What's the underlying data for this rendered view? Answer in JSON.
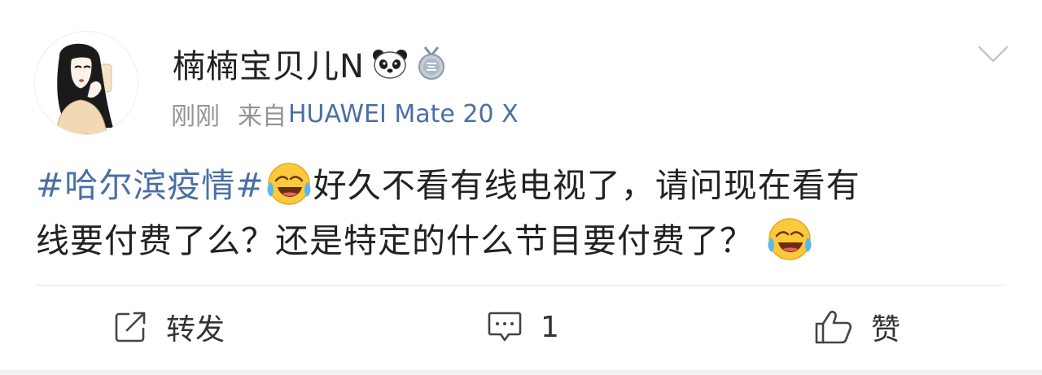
{
  "post": {
    "author": {
      "name": "楠楠宝贝儿N",
      "avatar_icon": "avatar-girl-illustration",
      "badges": [
        "panda-icon",
        "medal-badge-icon"
      ]
    },
    "time": "刚刚",
    "source_prefix": "来自",
    "source_device": "HUAWEI Mate 20 X",
    "menu_icon": "chevron-down-icon",
    "content": {
      "hashtag": "#哈尔滨疫情#",
      "line1_text": "好久不看有线电视了，请问现在看有",
      "line2_text": "线要付费了么？还是特定的什么节目要付费了？",
      "emoji": "laugh-cry-emoji"
    }
  },
  "actions": {
    "repost": {
      "icon": "share-icon",
      "label": "转发"
    },
    "comment": {
      "icon": "comment-icon",
      "label": "1"
    },
    "like": {
      "icon": "thumbs-up-icon",
      "label": "赞"
    }
  },
  "colors": {
    "link": "#4a6fa5",
    "text": "#222222",
    "secondary": "#939393",
    "divider": "#e6e6e6"
  }
}
